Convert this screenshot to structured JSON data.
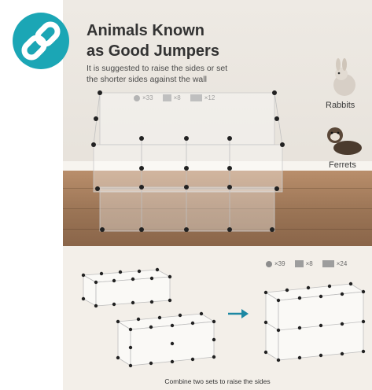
{
  "heading": {
    "title_line1": "Animals Known",
    "title_line2": "as Good Jumpers",
    "subtitle_line1": "It is suggested to raise the sides or set",
    "subtitle_line2": "the shorter sides against the wall"
  },
  "legend_top": {
    "items": [
      {
        "icon": "connector-icon",
        "text": "×33"
      },
      {
        "icon": "panel-icon",
        "text": "×8"
      },
      {
        "icon": "door-panel-icon",
        "text": "×12"
      }
    ]
  },
  "animals": [
    {
      "label": "Rabbits",
      "icon": "rabbit-icon"
    },
    {
      "label": "Ferrets",
      "icon": "ferret-icon"
    }
  ],
  "legend_bottom": {
    "items": [
      {
        "icon": "connector-icon",
        "text": "×39"
      },
      {
        "icon": "panel-icon",
        "text": "×8"
      },
      {
        "icon": "door-panel-icon",
        "text": "×24"
      }
    ]
  },
  "caption": "Combine two sets to raise the sides",
  "colors": {
    "logo": "#1ba6b5",
    "arrow": "#1d88a3",
    "panel_background": "#f3efe9"
  }
}
